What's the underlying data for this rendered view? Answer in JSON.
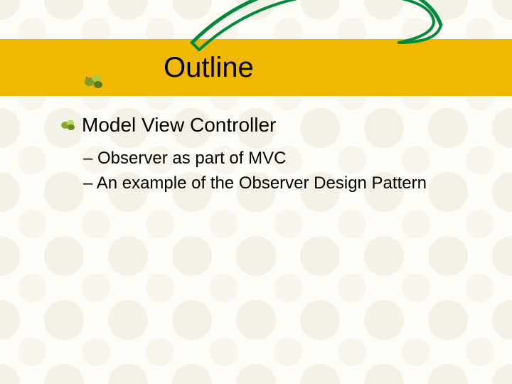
{
  "title": "Outline",
  "topic": "Model View Controller",
  "sub_items": [
    "– Observer as part of MVC",
    "– An example of the Observer Design Pattern"
  ],
  "colors": {
    "title_bar": "#f0b800",
    "swoosh": "#008a3a",
    "background": "#fdfcf6"
  }
}
